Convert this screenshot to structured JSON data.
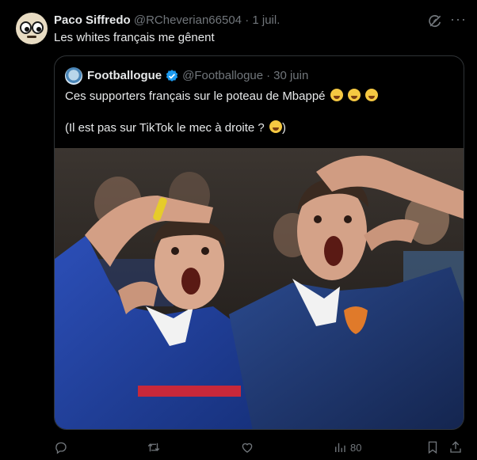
{
  "tweet": {
    "author_name": "Paco Siffredo",
    "author_handle": "@RCheverian66504",
    "separator": "·",
    "date": "1 juil.",
    "text": "Les whites français me gênent"
  },
  "quote": {
    "author_name": "Footballogue",
    "author_handle": "@Footballogue",
    "separator": "·",
    "date": "30 juin",
    "line1": "Ces supporters français sur le poteau de Mbappé",
    "line2": "(Il est pas sur TikTok le mec à droite ?",
    "line2_end": ")",
    "line1_emojis": [
      "loudly-crying-face",
      "loudly-crying-face",
      "loudly-crying-face"
    ],
    "line2_emoji": "grinning-face-with-sweat"
  },
  "actions": {
    "reply": "",
    "retweet": "",
    "like": "",
    "views": "80"
  },
  "colors": {
    "background": "#000000",
    "text": "#e7e9ea",
    "muted": "#71767b",
    "border": "#2f3336",
    "verified": "#1d9bf0",
    "jersey_blue": "#1f3f99"
  }
}
